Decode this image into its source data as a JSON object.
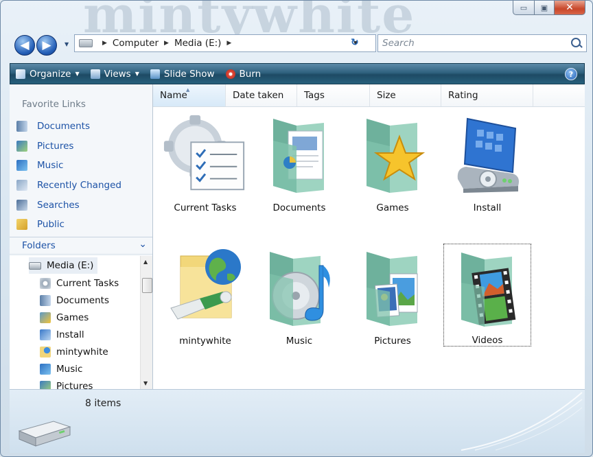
{
  "watermark": "mintywhite",
  "window_buttons": {
    "minimize": "▭",
    "maximize": "▣",
    "close": "✕"
  },
  "address": {
    "segments": [
      "Computer",
      "Media (E:)"
    ],
    "search_placeholder": "Search"
  },
  "toolbar": {
    "organize": "Organize",
    "views": "Views",
    "slideshow": "Slide Show",
    "burn": "Burn",
    "help": "?"
  },
  "favorites": {
    "title": "Favorite Links",
    "items": [
      "Documents",
      "Pictures",
      "Music",
      "Recently Changed",
      "Searches",
      "Public"
    ]
  },
  "folders": {
    "title": "Folders",
    "tree": [
      "Media (E:)",
      "Current Tasks",
      "Documents",
      "Games",
      "Install",
      "mintywhite",
      "Music",
      "Pictures"
    ]
  },
  "columns": [
    "Name",
    "Date taken",
    "Tags",
    "Size",
    "Rating"
  ],
  "items": [
    {
      "label": "Current Tasks",
      "icon": "tasks-icon"
    },
    {
      "label": "Documents",
      "icon": "documents-folder-icon"
    },
    {
      "label": "Games",
      "icon": "games-folder-icon"
    },
    {
      "label": "Install",
      "icon": "install-icon"
    },
    {
      "label": "mintywhite",
      "icon": "mintywhite-folder-icon"
    },
    {
      "label": "Music",
      "icon": "music-folder-icon"
    },
    {
      "label": "Pictures",
      "icon": "pictures-folder-icon"
    },
    {
      "label": "Videos",
      "icon": "videos-folder-icon"
    }
  ],
  "status": {
    "count": "8 items"
  },
  "colors": {
    "toolbar": "#2f617e",
    "link": "#1c52a6",
    "folder": "#7fbfa8"
  }
}
